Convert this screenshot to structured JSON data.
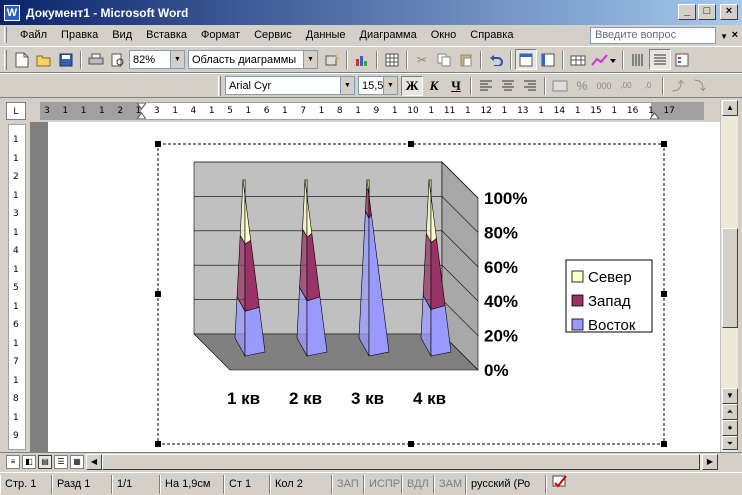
{
  "window": {
    "title": "Документ1 - Microsoft Word",
    "app_icon_label": "W",
    "controls": [
      "_",
      "□",
      "×"
    ]
  },
  "menu": {
    "items": [
      "Файл",
      "Правка",
      "Вид",
      "Вставка",
      "Формат",
      "Сервис",
      "Данные",
      "Диаграмма",
      "Окно",
      "Справка"
    ],
    "help_placeholder": "Введите вопрос",
    "doc_close": "×"
  },
  "toolbar": {
    "zoom": "82%",
    "chart_area": "Область диаграммы"
  },
  "format_toolbar": {
    "font": "Arial Cyr",
    "size": "15,5",
    "bold": "Ж",
    "italic": "К",
    "underline": "Ч"
  },
  "ruler": {
    "horizontal": [
      "3",
      "1",
      "1",
      "1",
      "2",
      "1",
      "3",
      "1",
      "4",
      "1",
      "5",
      "1",
      "6",
      "1",
      "7",
      "1",
      "8",
      "1",
      "9",
      "1",
      "10",
      "1",
      "11",
      "1",
      "12",
      "1",
      "13",
      "1",
      "14",
      "1",
      "15",
      "1",
      "16",
      "1",
      "17"
    ],
    "vertical": [
      "1",
      "1",
      "2",
      "1",
      "3",
      "1",
      "4",
      "1",
      "5",
      "1",
      "6",
      "1",
      "7",
      "1",
      "8",
      "1",
      "9"
    ],
    "tab_selector": "L"
  },
  "colors": {
    "north": "#ffffcc",
    "west": "#993366",
    "east": "#9999ff",
    "walls": "#c0c0c0",
    "floor": "#808080"
  },
  "chart_data": {
    "type": "bar",
    "subtype": "3d-100%-stacked-pyramid",
    "categories": [
      "1 кв",
      "2 кв",
      "3 кв",
      "4 кв"
    ],
    "series": [
      {
        "name": "Восток",
        "values": [
          26,
          32,
          80,
          27
        ]
      },
      {
        "name": "Запад",
        "values": [
          39,
          37,
          15,
          39
        ]
      },
      {
        "name": "Север",
        "values": [
          35,
          31,
          5,
          34
        ]
      }
    ],
    "y_ticks": [
      "0%",
      "20%",
      "40%",
      "60%",
      "80%",
      "100%"
    ],
    "ylim": [
      0,
      100
    ],
    "legend": [
      "Север",
      "Запад",
      "Восток"
    ],
    "legend_position": "right",
    "grid": true
  },
  "status": {
    "page": "Стр. 1",
    "section": "Разд 1",
    "pages": "1/1",
    "at": "На 1,9см",
    "line": "Ст 1",
    "col": "Кол 2",
    "rec": "ЗАП",
    "trk": "ИСПР",
    "ext": "ВДЛ",
    "ovr": "ЗАМ",
    "lang": "русский (Ро"
  }
}
